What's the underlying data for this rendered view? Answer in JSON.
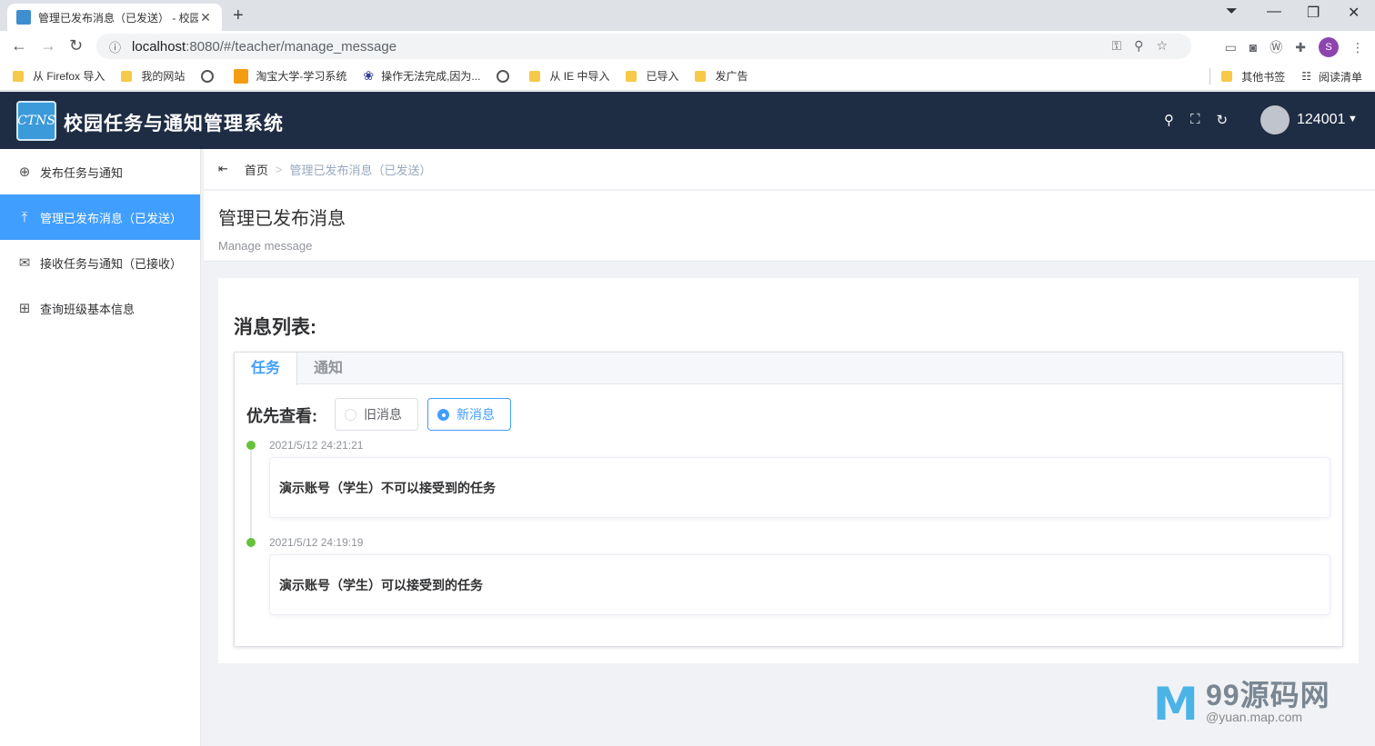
{
  "browser": {
    "tab_title": "管理已发布消息（已发送） - 校园",
    "url_host": "localhost",
    "url_path": ":8080/#/teacher/manage_message",
    "profile_initial": "S",
    "bookmarks": [
      "从 Firefox 导入",
      "我的网站",
      "淘宝大学-学习系统",
      "操作无法完成,因为...",
      "从 IE 中导入",
      "已导入",
      "发广告"
    ],
    "bookmarks_right": [
      "其他书签",
      "阅读清单"
    ]
  },
  "header": {
    "title": "校园任务与通知管理系统",
    "logo_text": "CTNS",
    "username": "124001"
  },
  "sidebar": {
    "items": [
      {
        "label": "发布任务与通知",
        "icon": "plus-circle-icon"
      },
      {
        "label": "管理已发布消息（已发送）",
        "icon": "upload-icon",
        "active": true
      },
      {
        "label": "接收任务与通知（已接收）",
        "icon": "inbox-icon"
      },
      {
        "label": "查询班级基本信息",
        "icon": "org-icon"
      }
    ]
  },
  "breadcrumb": {
    "home": "首页",
    "current": "管理已发布消息（已发送）"
  },
  "page": {
    "title": "管理已发布消息",
    "subtitle": "Manage message"
  },
  "card": {
    "title": "消息列表:",
    "tabs": [
      "任务",
      "通知"
    ],
    "active_tab": "任务",
    "filter_label": "优先查看:",
    "filter_options": [
      "旧消息",
      "新消息"
    ],
    "filter_selected": "新消息",
    "messages": [
      {
        "time": "2021/5/12 24:21:21",
        "content": "演示账号（学生）不可以接受到的任务"
      },
      {
        "time": "2021/5/12 24:19:19",
        "content": "演示账号（学生）可以接受到的任务"
      }
    ]
  },
  "watermark": {
    "brand": "99源码网",
    "sub": "@yuan.map.com"
  },
  "colors": {
    "header_bg": "#1f2d44",
    "accent": "#409eff",
    "timeline_dot": "#67c23a"
  }
}
